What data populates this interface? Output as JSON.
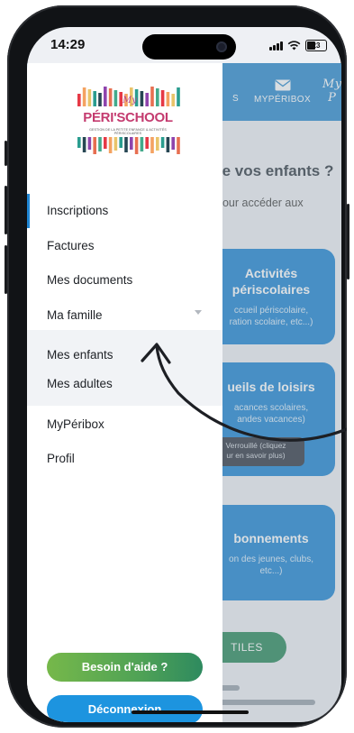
{
  "status": {
    "time": "14:29",
    "battery": "23"
  },
  "topnav": {
    "items": [
      {
        "label": "S"
      },
      {
        "label": "MYPÉRIBOX"
      }
    ],
    "brand": "My P"
  },
  "background": {
    "heading": "re vos enfants ?",
    "subhead": "pour accéder aux",
    "cards": [
      {
        "title": "Activités\npériscolaires",
        "subtitle": "ccueil périscolaire,\nration scolaire, etc...)"
      },
      {
        "title": "ueils de loisirs",
        "subtitle": "acances scolaires,\nandes vacances)"
      },
      {
        "title": "bonnements",
        "subtitle": "on des jeunes, clubs,\netc...)"
      }
    ],
    "locked_note": "Verrouillé (cliquez\nur en savoir plus)",
    "bottom_pill": "TILES"
  },
  "logo": {
    "wordmark_top": "My",
    "wordmark_main": "PÉRI'SCHOOL",
    "tagline": "GESTION DE LA PETITE ENFANCE & ACTIVITÉS PÉRISCOLAIRES",
    "colors": [
      "#e63946",
      "#f4a261",
      "#e9c46a",
      "#2a9d8f",
      "#264653",
      "#8e44ad",
      "#e76f51",
      "#43aa8b"
    ]
  },
  "menu": {
    "items": [
      "Inscriptions",
      "Factures",
      "Mes documents",
      "Ma famille"
    ],
    "submenu": [
      "Mes enfants",
      "Mes adultes"
    ],
    "items_after": [
      "MyPéribox",
      "Profil"
    ]
  },
  "buttons": {
    "help": "Besoin d'aide ?",
    "logout": "Déconnexion"
  }
}
